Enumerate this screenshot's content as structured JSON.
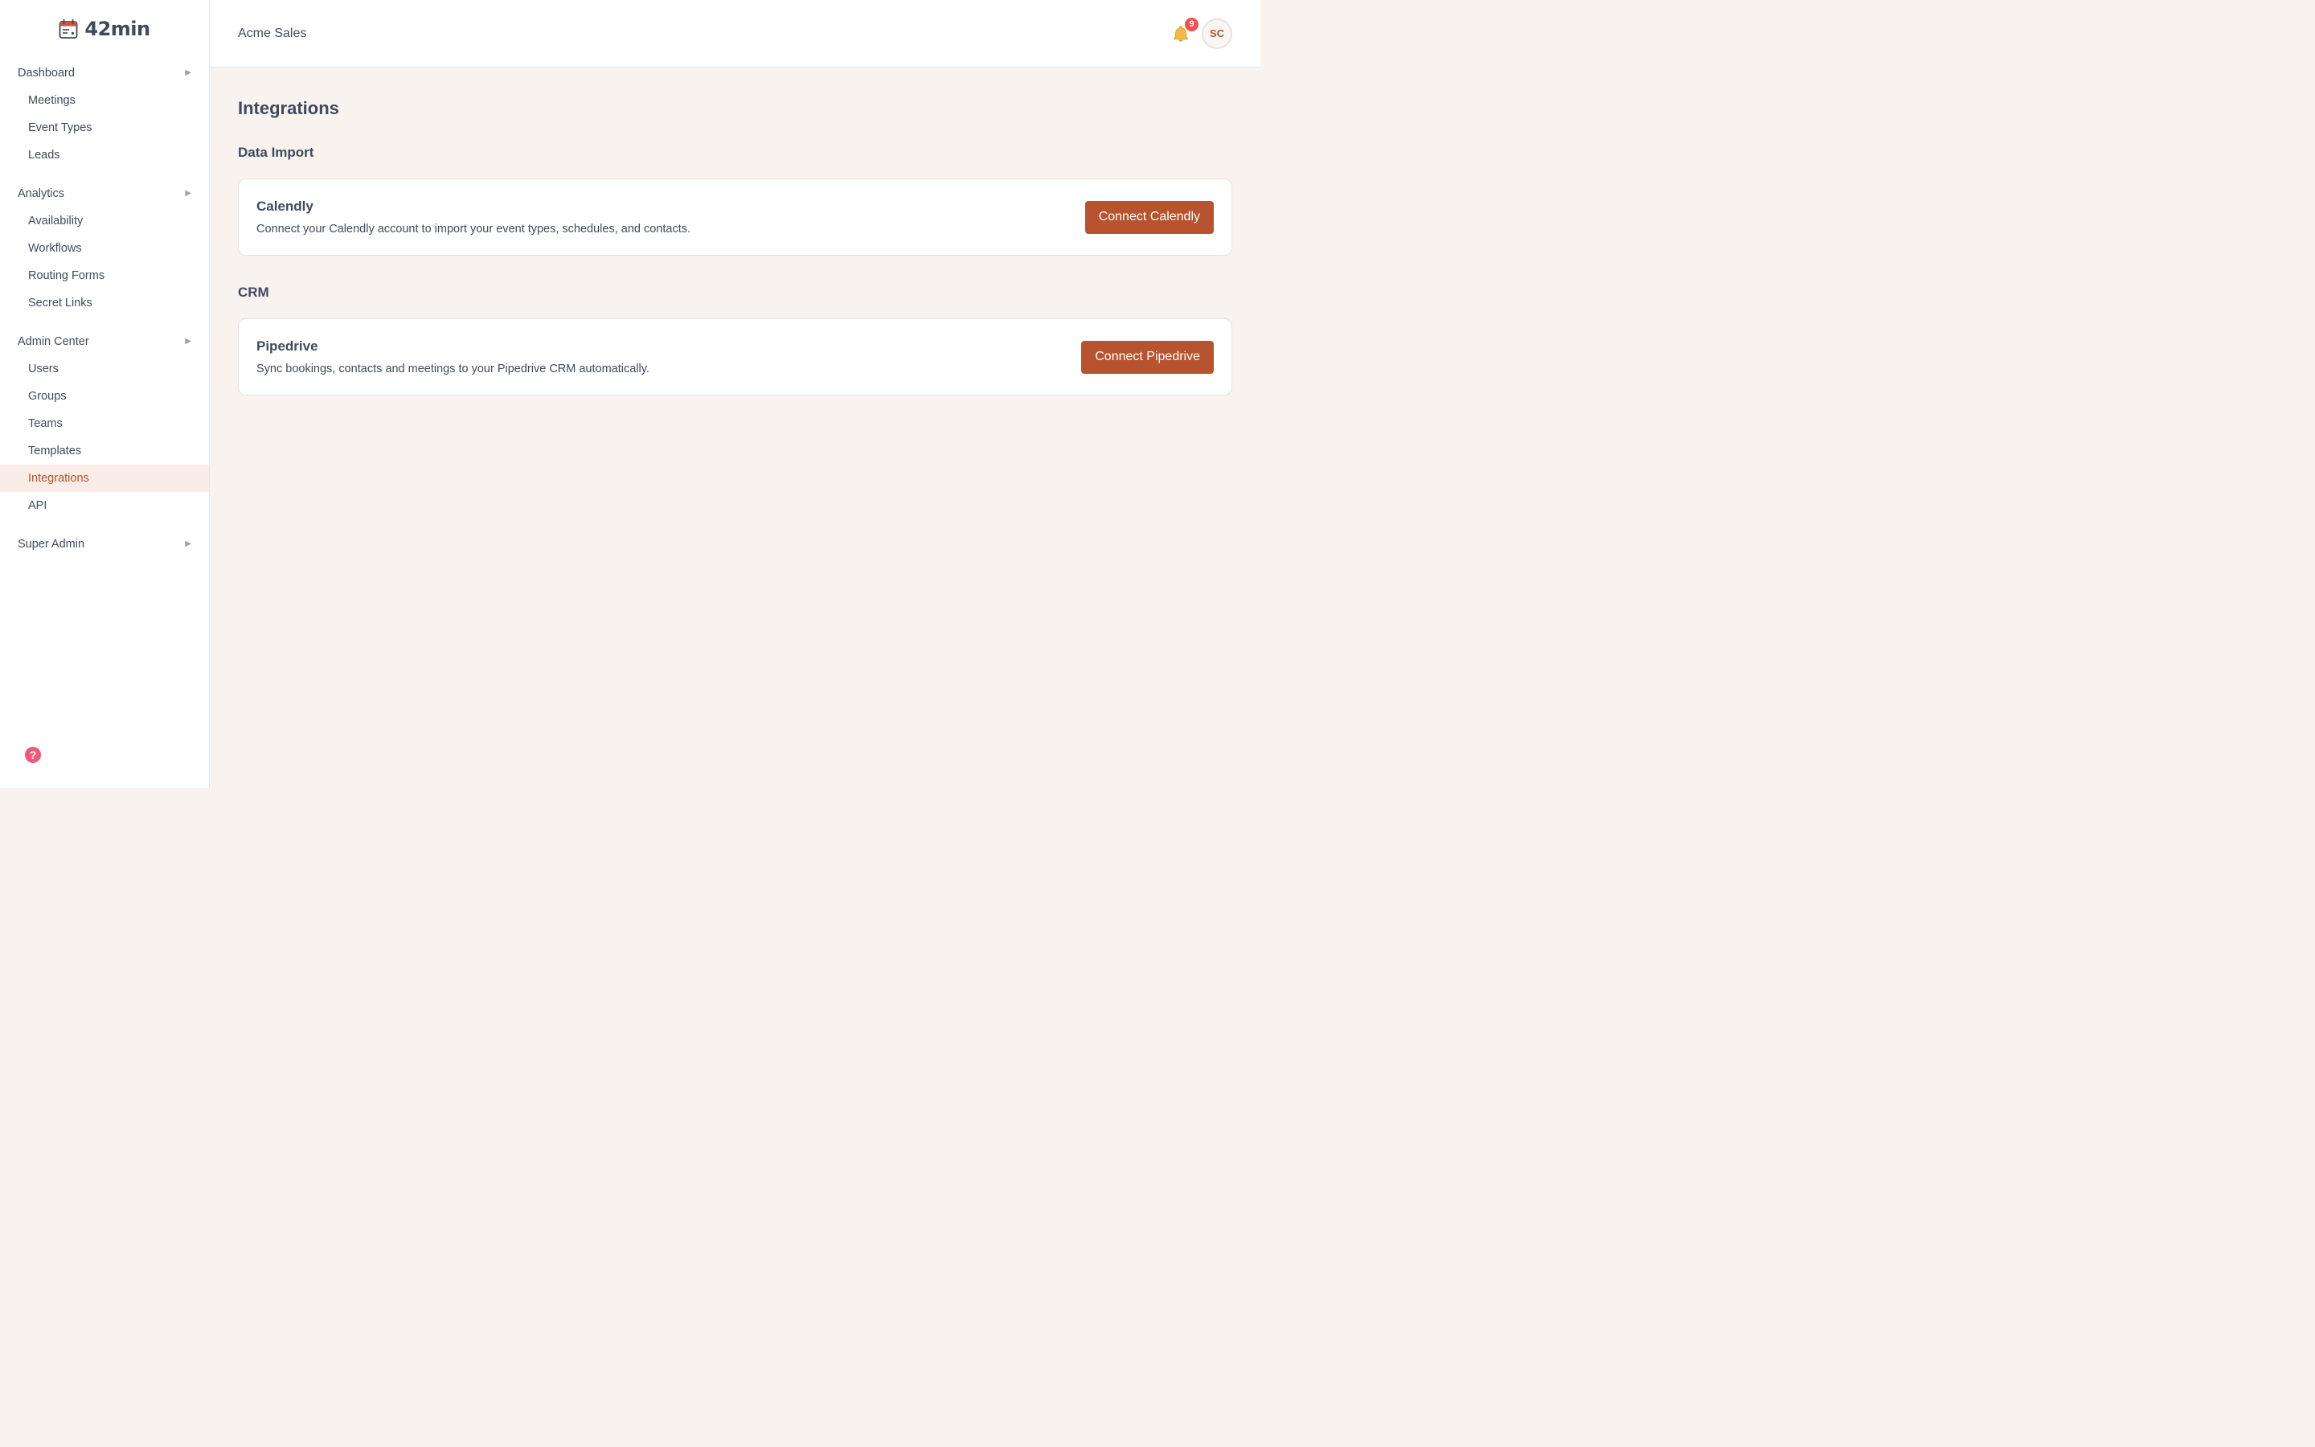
{
  "brand": {
    "name": "42min",
    "icon": "calendar-icon",
    "accent": "#b8532f"
  },
  "sidebar": {
    "groups": [
      {
        "label": "Dashboard",
        "items": [
          {
            "label": "Meetings"
          },
          {
            "label": "Event Types"
          },
          {
            "label": "Leads"
          }
        ]
      },
      {
        "label": "Analytics",
        "items": [
          {
            "label": "Availability"
          },
          {
            "label": "Workflows"
          },
          {
            "label": "Routing Forms"
          },
          {
            "label": "Secret Links"
          }
        ]
      },
      {
        "label": "Admin Center",
        "items": [
          {
            "label": "Users"
          },
          {
            "label": "Groups"
          },
          {
            "label": "Teams"
          },
          {
            "label": "Templates"
          },
          {
            "label": "Integrations",
            "active": true
          },
          {
            "label": "API"
          }
        ]
      },
      {
        "label": "Super Admin",
        "items": []
      }
    ],
    "help_icon": "help-circle-icon",
    "active_color": "#b5532f",
    "active_bg": "#f9ebe5"
  },
  "topbar": {
    "org_name": "Acme Sales",
    "notifications": {
      "icon": "bell-icon",
      "count": "9"
    },
    "avatar_initials": "SC"
  },
  "main": {
    "title": "Integrations",
    "sections": [
      {
        "title": "Data Import",
        "cards": [
          {
            "name": "Calendly",
            "description": "Connect your Calendly account to import your event types, schedules, and contacts.",
            "button": "Connect Calendly"
          }
        ]
      },
      {
        "title": "CRM",
        "cards": [
          {
            "name": "Pipedrive",
            "description": "Sync bookings, contacts and meetings to your Pipedrive CRM automatically.",
            "button": "Connect Pipedrive"
          }
        ]
      }
    ]
  }
}
